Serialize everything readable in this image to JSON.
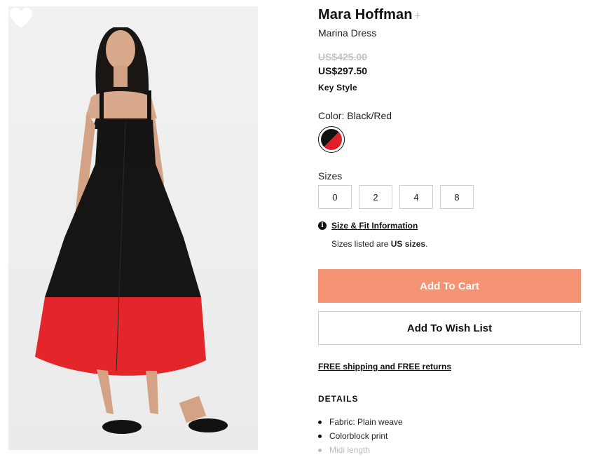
{
  "product": {
    "brand": "Mara Hoffman",
    "brand_plus": "+",
    "name": "Marina Dress",
    "original_price": "US$425.00",
    "sale_price": "US$297.50",
    "key_style": "Key Style",
    "image_icon": "heart-icon"
  },
  "color": {
    "label": "Color: Black/Red",
    "swatch_colors": [
      "#111111",
      "#e02027"
    ]
  },
  "sizes": {
    "label": "Sizes",
    "options": [
      "0",
      "2",
      "4",
      "8"
    ]
  },
  "fit": {
    "icon": "info-icon",
    "icon_glyph": "i",
    "link": "Size & Fit Information",
    "note_prefix": "Sizes listed are ",
    "note_bold": "US sizes",
    "note_suffix": "."
  },
  "actions": {
    "add_to_cart": "Add To Cart",
    "add_to_wish_list": "Add To Wish List",
    "cart_color": "#f49474"
  },
  "shipping": "FREE shipping and FREE returns",
  "details": {
    "heading": "DETAILS",
    "items": [
      "Fabric: Plain weave",
      "Colorblock print",
      "Midi length"
    ]
  }
}
